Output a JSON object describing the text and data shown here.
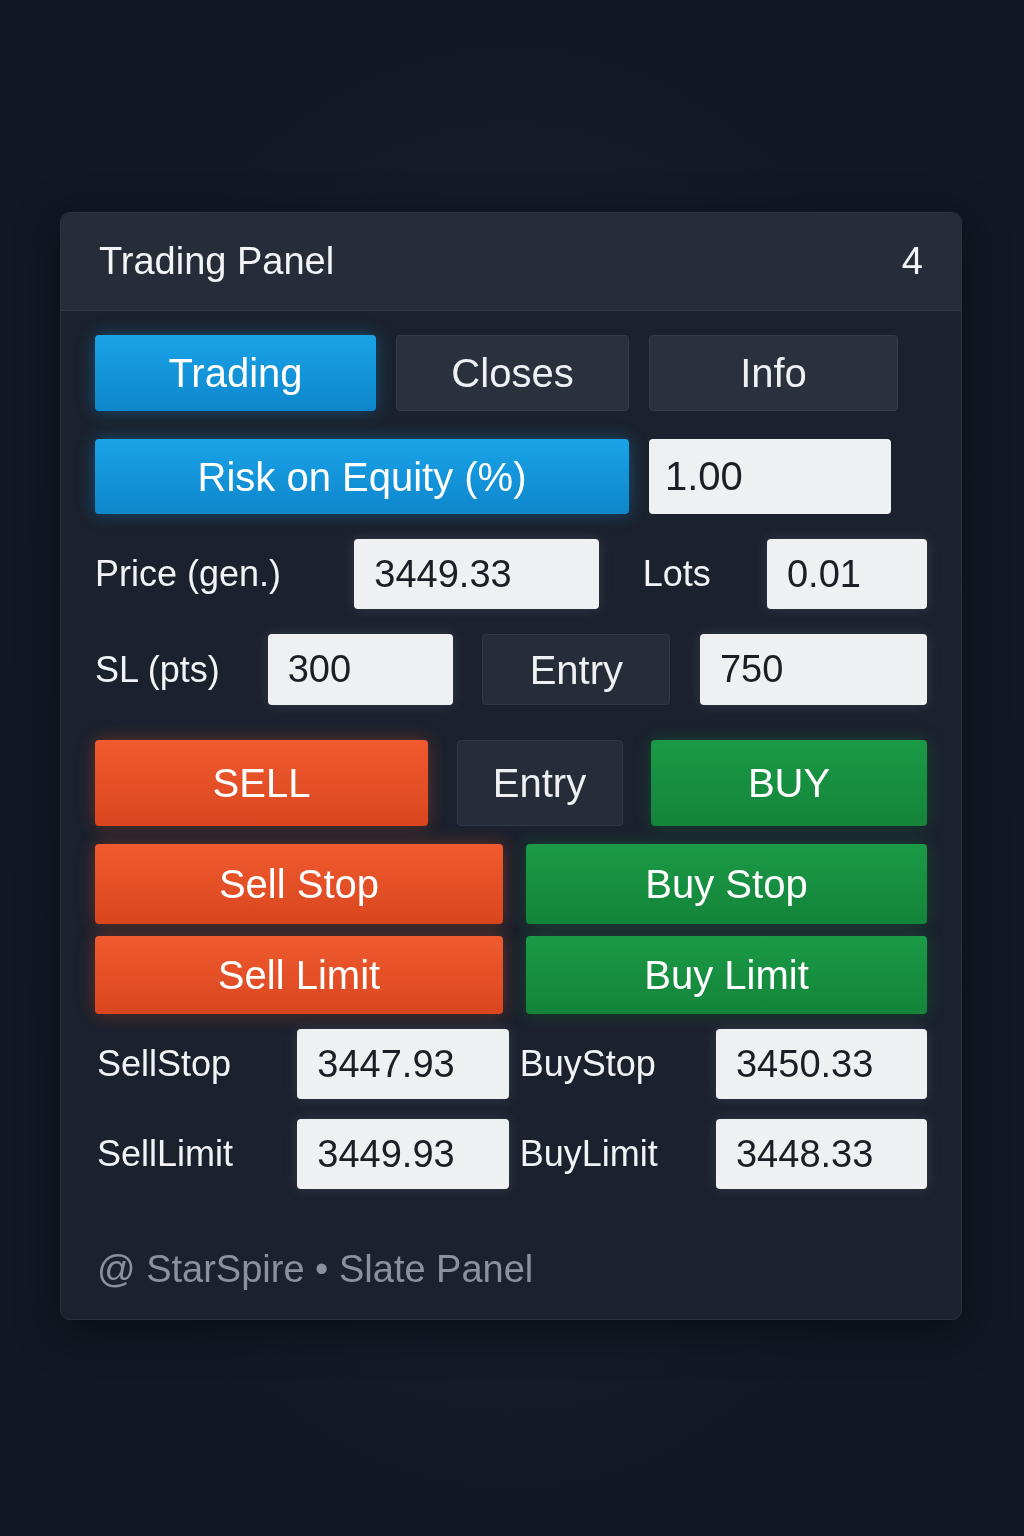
{
  "header": {
    "title": "Trading Panel",
    "count": "4"
  },
  "tabs": [
    {
      "label": "Trading",
      "selected": true
    },
    {
      "label": "Closes",
      "selected": false
    },
    {
      "label": "Info",
      "selected": false
    }
  ],
  "risk": {
    "label": "Risk on Equity (%)",
    "value": "1.00"
  },
  "rows": [
    [
      {
        "kind": "label",
        "text": "Price (gen.)"
      },
      {
        "kind": "field",
        "value": "3449.33"
      },
      {
        "kind": "label",
        "text": "Lots"
      },
      {
        "kind": "field",
        "value": "0.01"
      }
    ],
    [
      {
        "kind": "label",
        "text": "SL (pts)"
      },
      {
        "kind": "field",
        "value": "300"
      },
      {
        "kind": "neutral",
        "text": "Entry"
      },
      {
        "kind": "field",
        "value": "750"
      }
    ],
    [
      {
        "kind": "sell",
        "text": "SELL"
      },
      {
        "kind": "neutral",
        "text": "Entry"
      },
      {
        "kind": "buy",
        "text": "BUY"
      }
    ],
    [
      {
        "kind": "sell",
        "text": "Sell Stop"
      },
      {
        "kind": "buy",
        "text": "Buy Stop"
      }
    ],
    [
      {
        "kind": "sell",
        "text": "Sell Limit"
      },
      {
        "kind": "buy",
        "text": "Buy Limit"
      }
    ],
    [
      {
        "kind": "label",
        "text": "SellStop"
      },
      {
        "kind": "field",
        "value": "3447.93"
      },
      {
        "kind": "label",
        "text": "BuyStop"
      },
      {
        "kind": "field",
        "value": "3450.33"
      }
    ],
    [
      {
        "kind": "label",
        "text": "SellLimit"
      },
      {
        "kind": "field",
        "value": "3449.93"
      },
      {
        "kind": "label",
        "text": "BuyLimit"
      },
      {
        "kind": "field",
        "value": "3448.33"
      }
    ]
  ],
  "footer": "@ StarSpire • Slate Panel"
}
